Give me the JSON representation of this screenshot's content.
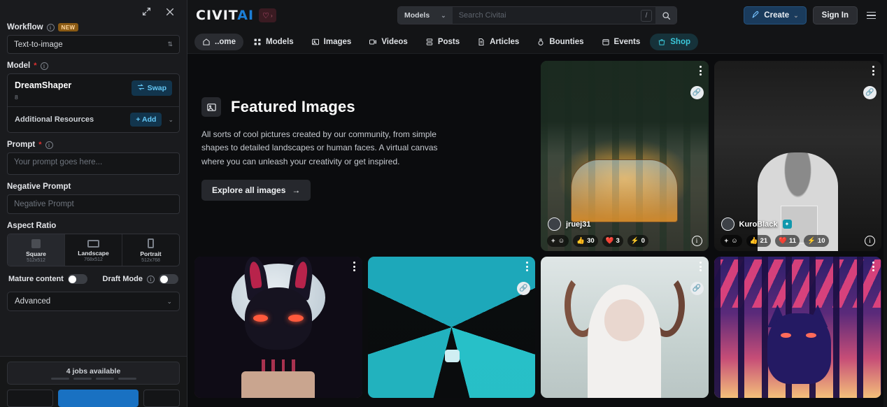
{
  "sidebar": {
    "expand_icon": "expand-icon",
    "close_icon": "close-icon",
    "workflow": {
      "label": "Workflow",
      "badge": "NEW",
      "value": "Text-to-image"
    },
    "model": {
      "label": "Model",
      "name": "DreamShaper",
      "version": "8",
      "swap_label": "Swap",
      "additional_resources_label": "Additional Resources",
      "add_label": "+ Add"
    },
    "prompt": {
      "label": "Prompt",
      "placeholder": "Your prompt goes here...",
      "value": ""
    },
    "negative_prompt": {
      "label": "Negative Prompt",
      "placeholder": "Negative Prompt",
      "value": ""
    },
    "aspect_ratio": {
      "label": "Aspect Ratio",
      "options": [
        {
          "name": "Square",
          "dims": "512x512",
          "selected": true
        },
        {
          "name": "Landscape",
          "dims": "768x512",
          "selected": false
        },
        {
          "name": "Portrait",
          "dims": "512x768",
          "selected": false
        }
      ]
    },
    "toggles": [
      {
        "label": "Mature content",
        "on": false
      },
      {
        "label": "Draft Mode",
        "on": false
      }
    ],
    "advanced_label": "Advanced",
    "footer": {
      "jobs_text": "4 jobs available"
    }
  },
  "header": {
    "logo_primary": "CIVIT",
    "logo_accent": "AI",
    "heart_icon": "heart-icon",
    "search": {
      "category": "Models",
      "placeholder": "Search Civitai",
      "value": "",
      "shortcut": "/"
    },
    "create_label": "Create",
    "signin_label": "Sign In"
  },
  "nav": {
    "items": [
      {
        "label": "..ome",
        "icon": "home-icon",
        "state": "active"
      },
      {
        "label": "Models",
        "icon": "models-icon",
        "state": "default"
      },
      {
        "label": "Images",
        "icon": "image-icon",
        "state": "default"
      },
      {
        "label": "Videos",
        "icon": "video-icon",
        "state": "default"
      },
      {
        "label": "Posts",
        "icon": "posts-icon",
        "state": "default"
      },
      {
        "label": "Articles",
        "icon": "article-icon",
        "state": "default"
      },
      {
        "label": "Bounties",
        "icon": "bounty-icon",
        "state": "default"
      },
      {
        "label": "Events",
        "icon": "calendar-icon",
        "state": "default"
      },
      {
        "label": "Shop",
        "icon": "shop-icon",
        "state": "highlighted"
      }
    ]
  },
  "feature": {
    "icon": "image-icon",
    "title": "Featured Images",
    "description": "All sorts of cool pictures created by our community, from simple shapes to detailed landscapes or human faces. A virtual canvas where you can unleash your creativity or get inspired.",
    "cta_label": "Explore all images",
    "cta_arrow": "arrow-right-icon"
  },
  "cards": [
    {
      "subject": "glass greenhouse in misty forest",
      "username": "jruej31",
      "verified": false,
      "has_link_badge": true,
      "reactions": {
        "thumbs": "30",
        "heart": "3",
        "bolt": "0"
      }
    },
    {
      "subject": "black and white man holding photograph",
      "username": "KuroBlack",
      "verified": true,
      "has_link_badge": true,
      "reactions": {
        "thumbs": "21",
        "heart": "11",
        "bolt": "10"
      }
    },
    {
      "subject": "dark rabbit with birthday cake under moon",
      "username": "",
      "verified": false,
      "has_link_badge": false,
      "reactions": null
    },
    {
      "subject": "teal crystal tunnel corridor",
      "username": "",
      "verified": false,
      "has_link_badge": true,
      "reactions": null
    },
    {
      "subject": "white haired woman with ram horns",
      "username": "",
      "verified": false,
      "has_link_badge": true,
      "reactions": null
    },
    {
      "subject": "pixel art wolf in neon forest",
      "username": "",
      "verified": false,
      "has_link_badge": false,
      "reactions": null
    }
  ],
  "colors": {
    "accent_blue": "#1c7ed6",
    "shop_teal": "#3bc9db",
    "swap_blue": "#63c7f5",
    "new_badge": "#8a5a14",
    "panel_bg": "#1a1b1e",
    "page_bg": "#0b0c0e"
  }
}
